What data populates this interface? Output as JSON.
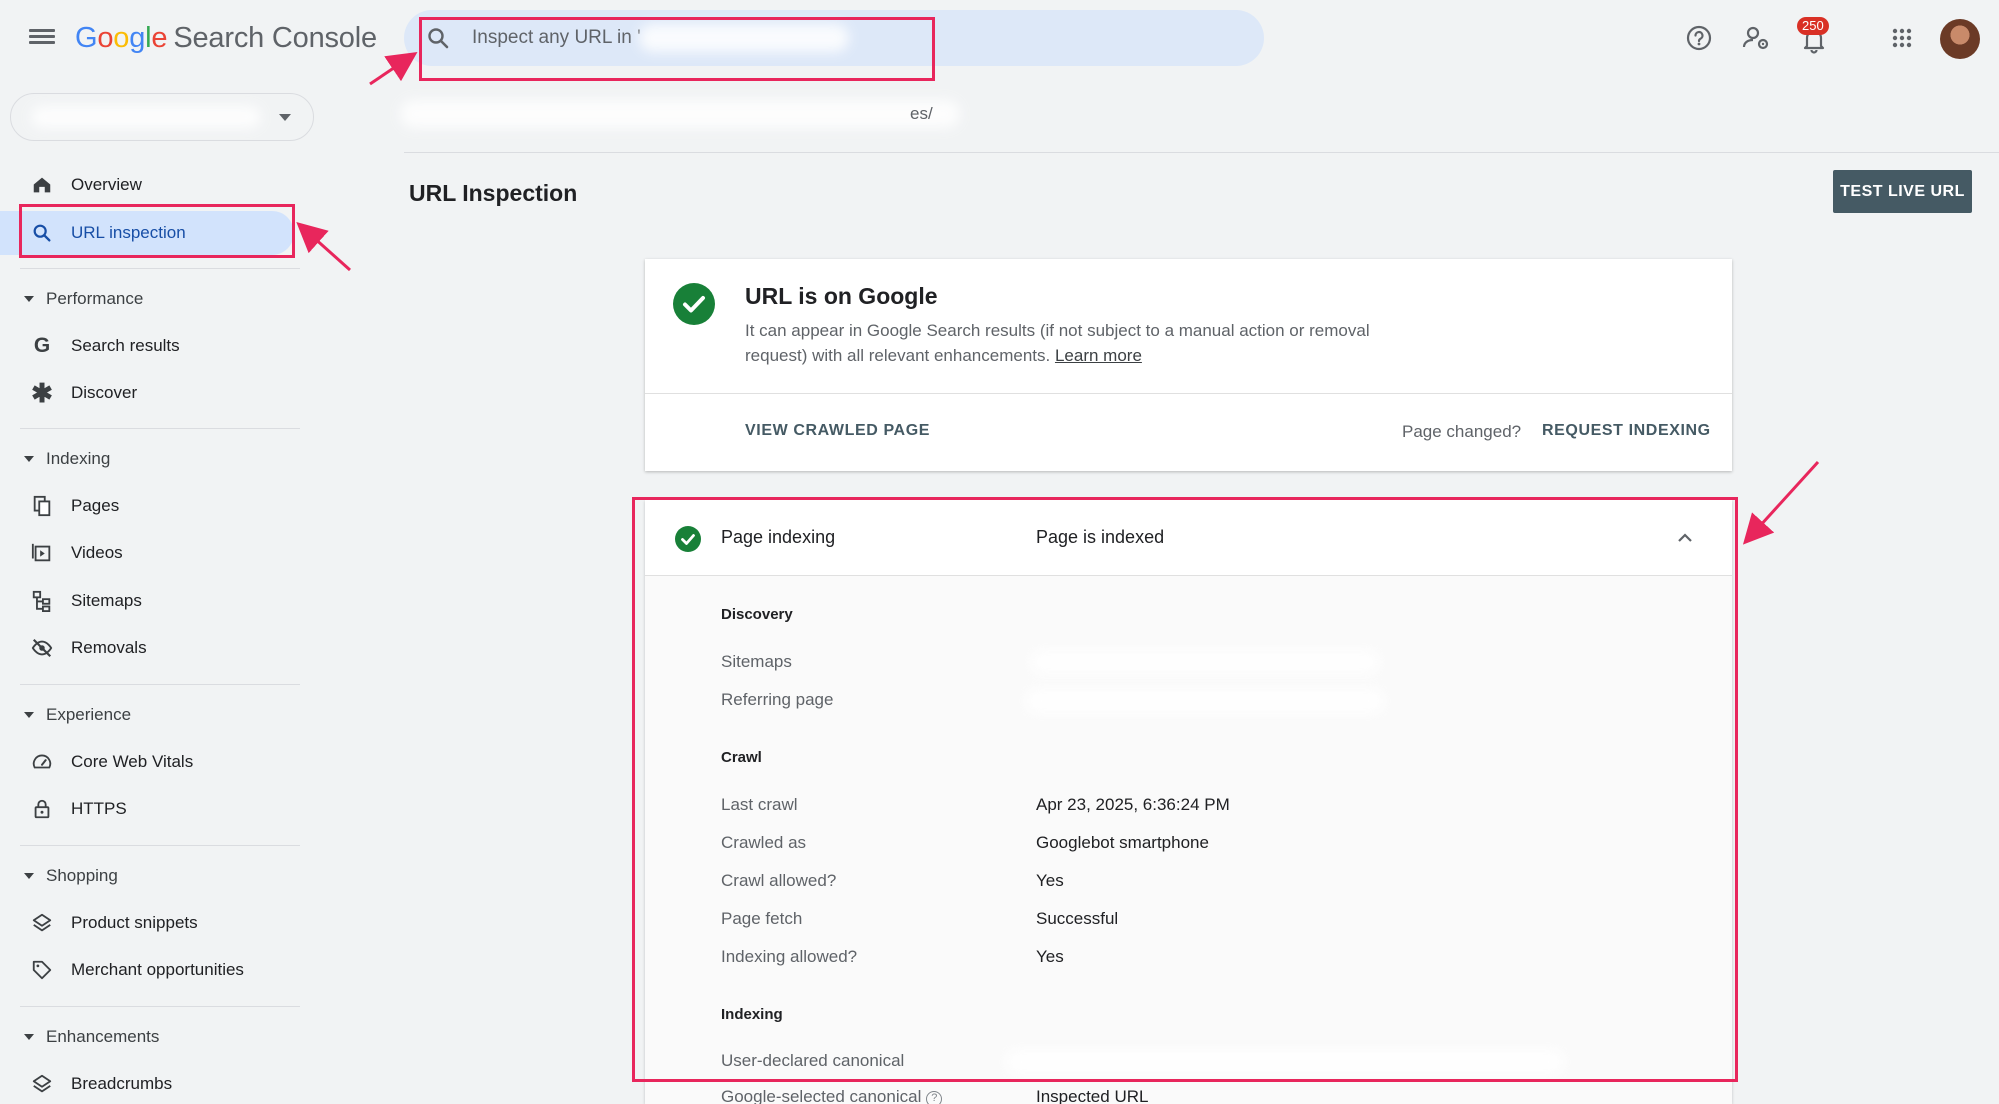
{
  "app": {
    "logo_letters": [
      "G",
      "o",
      "o",
      "g",
      "l",
      "e"
    ],
    "logo_product": "Search Console"
  },
  "search": {
    "placeholder": "Inspect any URL in '"
  },
  "header": {
    "notification_count": "250"
  },
  "sidebar": {
    "overview": "Overview",
    "url_inspection": "URL inspection",
    "sections": {
      "performance": "Performance",
      "indexing": "Indexing",
      "experience": "Experience",
      "shopping": "Shopping",
      "enhancements": "Enhancements"
    },
    "items": {
      "search_results": "Search results",
      "discover": "Discover",
      "pages": "Pages",
      "videos": "Videos",
      "sitemaps": "Sitemaps",
      "removals": "Removals",
      "core_web_vitals": "Core Web Vitals",
      "https": "HTTPS",
      "product_snippets": "Product snippets",
      "merchant_opportunities": "Merchant opportunities",
      "breadcrumbs": "Breadcrumbs"
    }
  },
  "breadcrumb": {
    "tail": "es/"
  },
  "main": {
    "title": "URL Inspection",
    "test_live_label": "TEST LIVE URL"
  },
  "status_card": {
    "title": "URL is on Google",
    "description": "It can appear in Google Search results (if not subject to a manual action or removal request) with all relevant enhancements.",
    "learn_more": "Learn more",
    "view_crawled": "VIEW CRAWLED PAGE",
    "page_changed": "Page changed?",
    "request_indexing": "REQUEST INDEXING"
  },
  "indexing_panel": {
    "label": "Page indexing",
    "value": "Page is indexed",
    "discovery": {
      "header": "Discovery",
      "sitemaps_label": "Sitemaps",
      "referring_label": "Referring page"
    },
    "crawl": {
      "header": "Crawl",
      "rows": [
        {
          "label": "Last crawl",
          "value": "Apr 23, 2025, 6:36:24 PM"
        },
        {
          "label": "Crawled as",
          "value": "Googlebot smartphone"
        },
        {
          "label": "Crawl allowed?",
          "value": "Yes"
        },
        {
          "label": "Page fetch",
          "value": "Successful"
        },
        {
          "label": "Indexing allowed?",
          "value": "Yes"
        }
      ]
    },
    "indexing": {
      "header": "Indexing",
      "user_canonical_label": "User-declared canonical",
      "google_canonical_label": "Google-selected canonical",
      "google_canonical_value": "Inspected URL"
    }
  },
  "colors": {
    "accent_blue": "#174ea6",
    "active_bg": "#d2e3fc",
    "success_green": "#188038",
    "annotation_pink": "#e8265c",
    "button_slate": "#455a64"
  }
}
